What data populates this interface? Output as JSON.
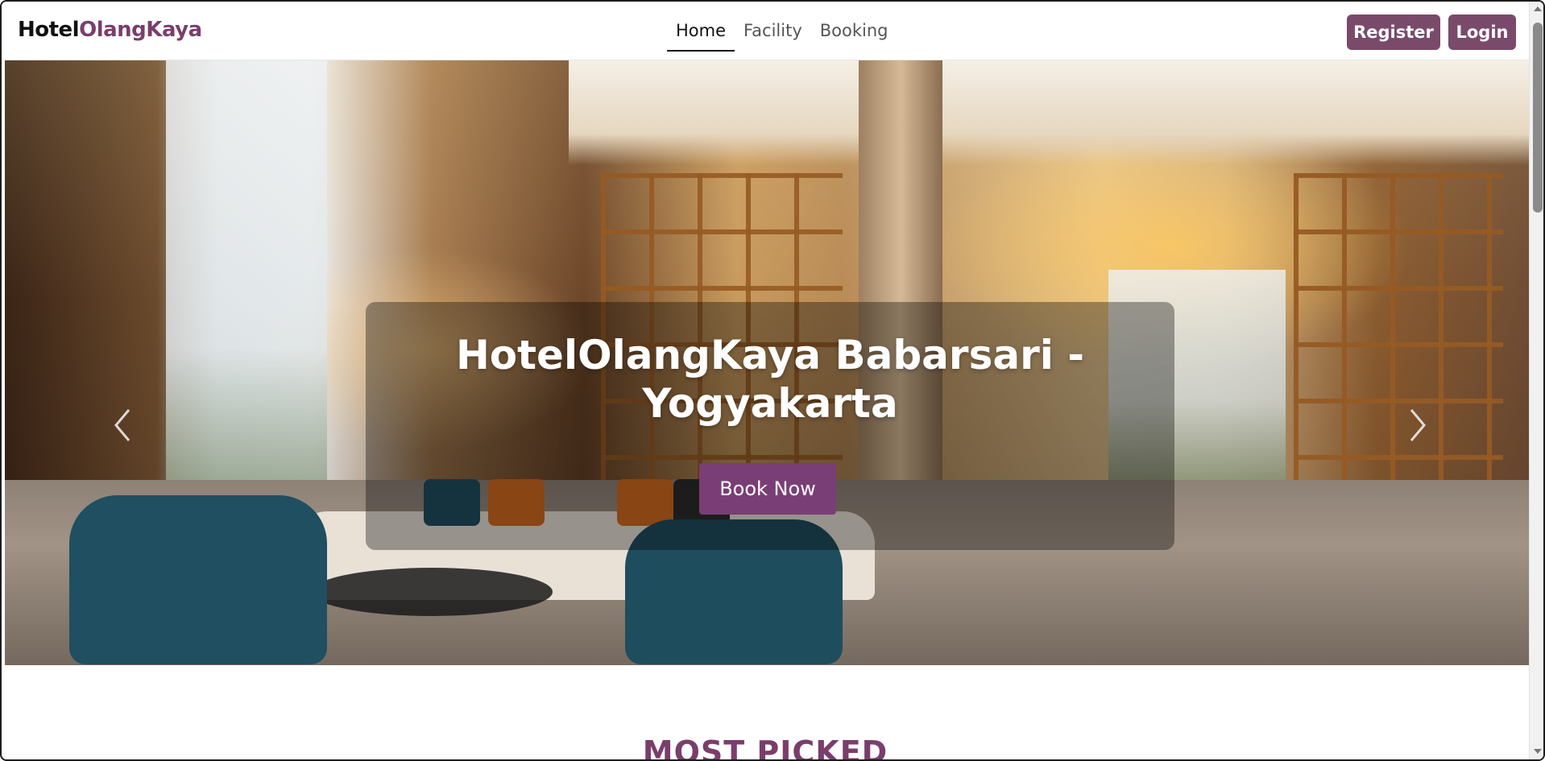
{
  "navbar": {
    "brand_part1": "Hotel",
    "brand_part2": "OlangKaya",
    "links": [
      {
        "label": "Home",
        "active": true
      },
      {
        "label": "Facility",
        "active": false
      },
      {
        "label": "Booking",
        "active": false
      }
    ],
    "register_label": "Register",
    "login_label": "Login"
  },
  "hero": {
    "title": "HotelOlangKaya Babarsari - Yogyakarta",
    "cta_label": "Book Now",
    "prev_icon": "chevron-left-icon",
    "next_icon": "chevron-right-icon",
    "slide_count": 5,
    "active_slide": 1
  },
  "sections": {
    "most_picked_title": "MOST PICKED"
  },
  "colors": {
    "brand_accent": "#7a3e6c",
    "button_bg": "#7a4a6b",
    "cta_bg": "#7a3e76"
  }
}
